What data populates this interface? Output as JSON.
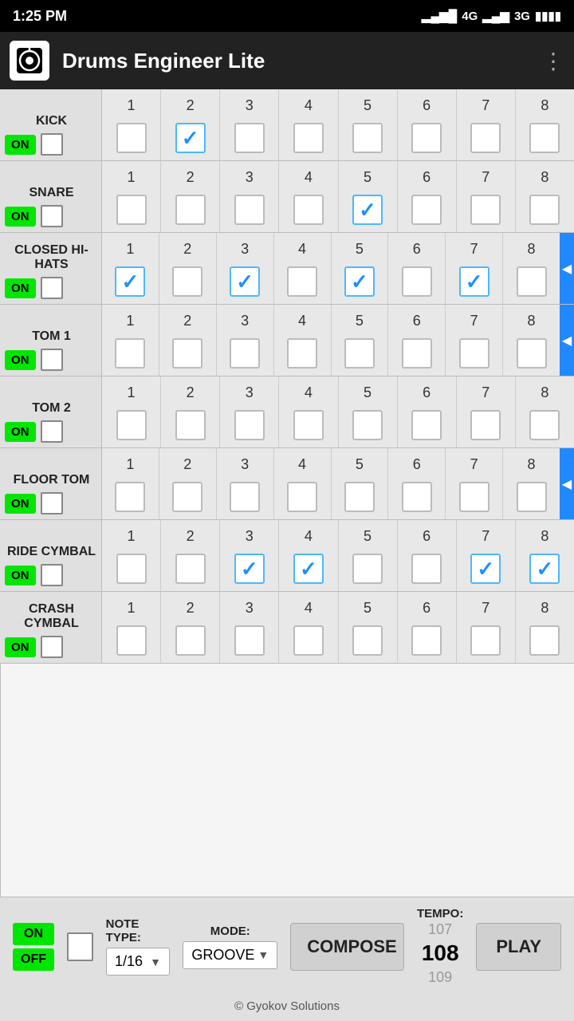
{
  "statusBar": {
    "time": "1:25 PM",
    "signal1": "▂▄▆█",
    "network1": "4G",
    "signal2": "▂▄▆",
    "network2": "3G",
    "battery": "🔋"
  },
  "titleBar": {
    "appName": "Drums Engineer Lite",
    "menuIcon": "⋮"
  },
  "drums": [
    {
      "id": "kick",
      "name": "KICK",
      "on": true,
      "hasArrow": false,
      "beats": [
        false,
        true,
        false,
        false,
        false,
        false,
        false,
        false
      ]
    },
    {
      "id": "snare",
      "name": "SNARE",
      "on": true,
      "hasArrow": false,
      "beats": [
        false,
        false,
        false,
        false,
        true,
        false,
        false,
        false
      ]
    },
    {
      "id": "closed-hi-hats",
      "name": "CLOSED HI-HATS",
      "on": true,
      "hasArrow": true,
      "beats": [
        true,
        false,
        true,
        false,
        true,
        false,
        true,
        false
      ]
    },
    {
      "id": "tom-1",
      "name": "TOM 1",
      "on": true,
      "hasArrow": true,
      "beats": [
        false,
        false,
        false,
        false,
        false,
        false,
        false,
        false
      ]
    },
    {
      "id": "tom-2",
      "name": "TOM 2",
      "on": true,
      "hasArrow": false,
      "beats": [
        false,
        false,
        false,
        false,
        false,
        false,
        false,
        false
      ]
    },
    {
      "id": "floor-tom",
      "name": "FLOOR TOM",
      "on": true,
      "hasArrow": true,
      "beats": [
        false,
        false,
        false,
        false,
        false,
        false,
        false,
        false
      ]
    },
    {
      "id": "ride-cymbal",
      "name": "RIDE CYMBAL",
      "on": true,
      "hasArrow": false,
      "beats": [
        false,
        false,
        true,
        true,
        false,
        false,
        true,
        true
      ]
    },
    {
      "id": "crash-cymbal",
      "name": "CRASH CYMBAL",
      "on": true,
      "hasArrow": false,
      "beats": [
        false,
        false,
        false,
        false,
        false,
        false,
        false,
        false
      ]
    }
  ],
  "beatNumbers": [
    1,
    2,
    3,
    4,
    5,
    6,
    7,
    8
  ],
  "bottomBar": {
    "onLabel": "ON",
    "offLabel": "OFF",
    "noteTypeLabel": "NOTE TYPE:",
    "noteTypeValue": "1/16",
    "modeLabel": "MODE:",
    "modeValue": "GROOVE",
    "composeLabel": "COMPOSE",
    "tempoLabel": "TEMPO:",
    "tempoAbove": "107",
    "tempoCurrent": "108",
    "tempoBelow": "109",
    "playLabel": "PLAY"
  },
  "copyright": "© Gyokov Solutions"
}
